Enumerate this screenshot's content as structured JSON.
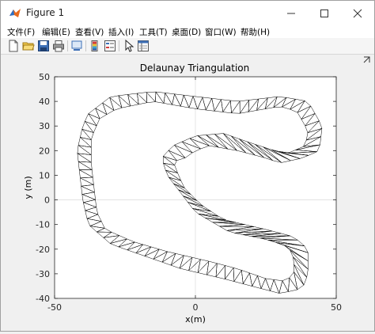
{
  "window": {
    "title": "Figure 1",
    "controls": {
      "minimize": "minimize-icon",
      "maximize": "maximize-icon",
      "close": "close-icon"
    }
  },
  "menu": {
    "items": [
      {
        "label": "文件(F)"
      },
      {
        "label": "编辑(E)"
      },
      {
        "label": "查看(V)"
      },
      {
        "label": "插入(I)"
      },
      {
        "label": "工具(T)"
      },
      {
        "label": "桌面(D)"
      },
      {
        "label": "窗口(W)"
      },
      {
        "label": "帮助(H)"
      }
    ]
  },
  "toolbar": {
    "icons": [
      "new-figure-icon",
      "open-file-icon",
      "save-icon",
      "print-icon",
      "link-plot-icon",
      "colorbar-icon",
      "legend-icon",
      "pointer-icon",
      "property-editor-icon"
    ]
  },
  "colors": {
    "mesh": "#000000",
    "axes_background": "#ffffff",
    "figure_background": "#f0f0f0",
    "grid": "#dfdfdf"
  },
  "chart_data": {
    "type": "scatter",
    "title": "Delaunay Triangulation",
    "xlabel": "x(m)",
    "ylabel": "y (m)",
    "xlim": [
      -50,
      50
    ],
    "ylim": [
      -40,
      50
    ],
    "xticks": [
      "-50",
      "0",
      "50"
    ],
    "yticks": [
      "-40",
      "-30",
      "-20",
      "-10",
      "0",
      "10",
      "20",
      "30",
      "40",
      "50"
    ],
    "grid": "major (x at 0, y at 0)",
    "outer_boundary": [
      [
        -38,
        35
      ],
      [
        -30,
        42
      ],
      [
        -15,
        44
      ],
      [
        0,
        42
      ],
      [
        15,
        40
      ],
      [
        30,
        42
      ],
      [
        40,
        40
      ],
      [
        45,
        30
      ],
      [
        44,
        20
      ],
      [
        38,
        17
      ],
      [
        30,
        15
      ],
      [
        25,
        17
      ],
      [
        15,
        20
      ],
      [
        5,
        22
      ],
      [
        0,
        20
      ],
      [
        -5,
        16
      ],
      [
        -8,
        16
      ],
      [
        -6,
        10
      ],
      [
        -4,
        5
      ],
      [
        2,
        -2
      ],
      [
        10,
        -8
      ],
      [
        25,
        -12
      ],
      [
        35,
        -15
      ],
      [
        40,
        -20
      ],
      [
        40,
        -30
      ],
      [
        38,
        -36
      ],
      [
        30,
        -38
      ],
      [
        20,
        -35
      ],
      [
        10,
        -32
      ],
      [
        -5,
        -28
      ],
      [
        -15,
        -24
      ],
      [
        -30,
        -18
      ],
      [
        -38,
        -10
      ],
      [
        -40,
        0
      ],
      [
        -41,
        10
      ],
      [
        -42,
        20
      ],
      [
        -40,
        30
      ]
    ],
    "inner_boundary": [
      [
        -34,
        33
      ],
      [
        -28,
        37
      ],
      [
        -15,
        40
      ],
      [
        0,
        37
      ],
      [
        15,
        35
      ],
      [
        30,
        38
      ],
      [
        36,
        36
      ],
      [
        40,
        28
      ],
      [
        39,
        22
      ],
      [
        33,
        19
      ],
      [
        28,
        20
      ],
      [
        20,
        23
      ],
      [
        10,
        27
      ],
      [
        0,
        26
      ],
      [
        -8,
        22
      ],
      [
        -12,
        17
      ],
      [
        -10,
        10
      ],
      [
        -6,
        4
      ],
      [
        0,
        -5
      ],
      [
        12,
        -13
      ],
      [
        25,
        -16
      ],
      [
        33,
        -19
      ],
      [
        35,
        -24
      ],
      [
        35,
        -30
      ],
      [
        32,
        -33
      ],
      [
        25,
        -32
      ],
      [
        15,
        -28
      ],
      [
        5,
        -25
      ],
      [
        -10,
        -21
      ],
      [
        -22,
        -17
      ],
      [
        -32,
        -12
      ],
      [
        -35,
        -5
      ],
      [
        -36,
        5
      ],
      [
        -37,
        15
      ],
      [
        -37,
        25
      ]
    ]
  }
}
